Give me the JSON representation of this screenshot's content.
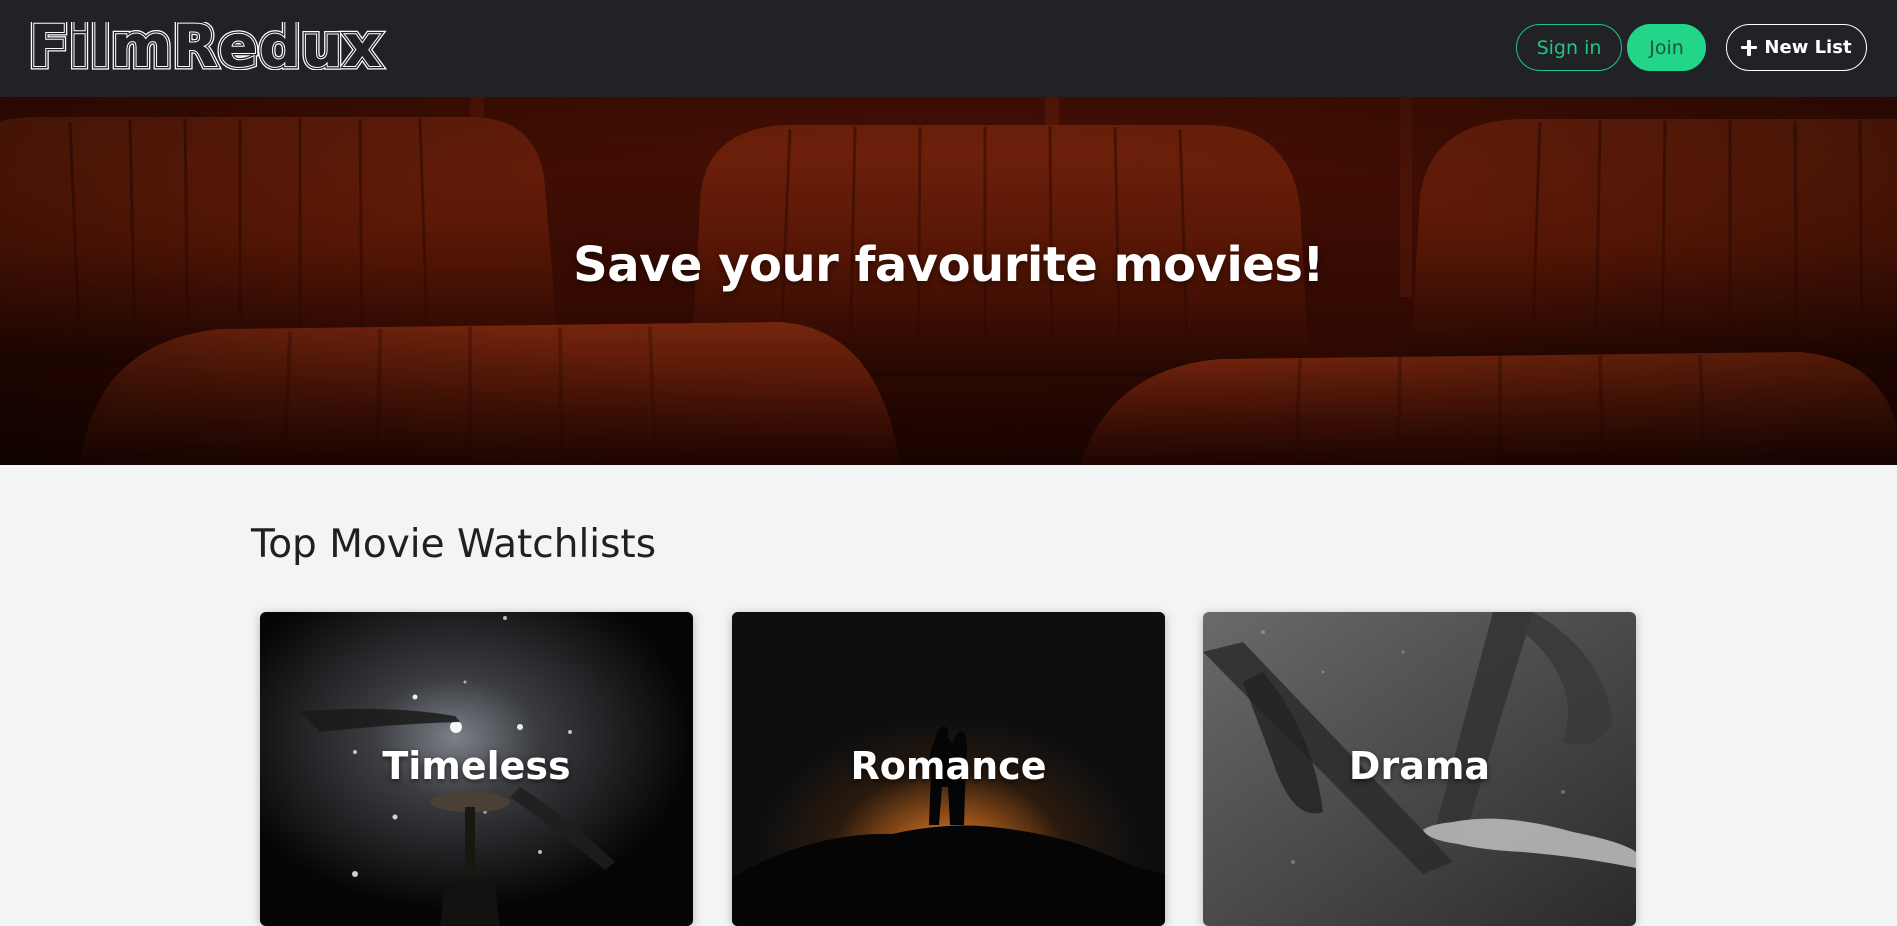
{
  "navbar": {
    "brand": "FilmRedux",
    "signin_label": "Sign in",
    "join_label": "Join",
    "newlist_label": "New List"
  },
  "hero": {
    "title": "Save your favourite movies!"
  },
  "main": {
    "section_title": "Top Movie Watchlists",
    "watchlists": [
      {
        "label": "Timeless",
        "image": "hands-spotlight-table"
      },
      {
        "label": "Romance",
        "image": "couple-silhouette-sunset"
      },
      {
        "label": "Drama",
        "image": "underwater-chair-hand"
      }
    ]
  },
  "colors": {
    "navbar_bg": "#202226",
    "accent_green": "#23d589",
    "page_bg": "#f3f4f4",
    "hero_red": "#8a2008"
  },
  "icons": {
    "new_list": "plus-icon"
  }
}
